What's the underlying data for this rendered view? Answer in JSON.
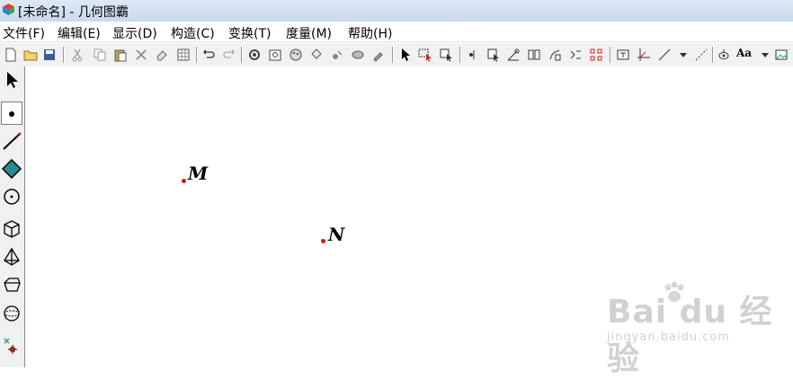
{
  "window": {
    "title": "[未命名] - 几何图霸"
  },
  "menubar": {
    "items": [
      {
        "label": "文件(F)"
      },
      {
        "label": "编辑(E)"
      },
      {
        "label": "显示(D)"
      },
      {
        "label": "构造(C)"
      },
      {
        "label": "变换(T)"
      },
      {
        "label": "度量(M)"
      },
      {
        "label": "帮助(H)"
      }
    ]
  },
  "toolbar": {
    "text_style_label": "Aa"
  },
  "toolbox": {
    "tools": [
      "arrow-select-tool",
      "point-tool",
      "segment-tool",
      "polygon-tool",
      "circle-tool",
      "cube-tool",
      "pyramid-tool",
      "prism-tool",
      "sphere-tool",
      "custom-tool"
    ],
    "active": "point-tool"
  },
  "canvas": {
    "points": [
      {
        "label": "M",
        "color": "#cc1a1a"
      },
      {
        "label": "N",
        "color": "#cc1a1a"
      }
    ]
  },
  "watermark": {
    "brand": "Bai du 经验",
    "url": "jingyan.baidu.com"
  }
}
